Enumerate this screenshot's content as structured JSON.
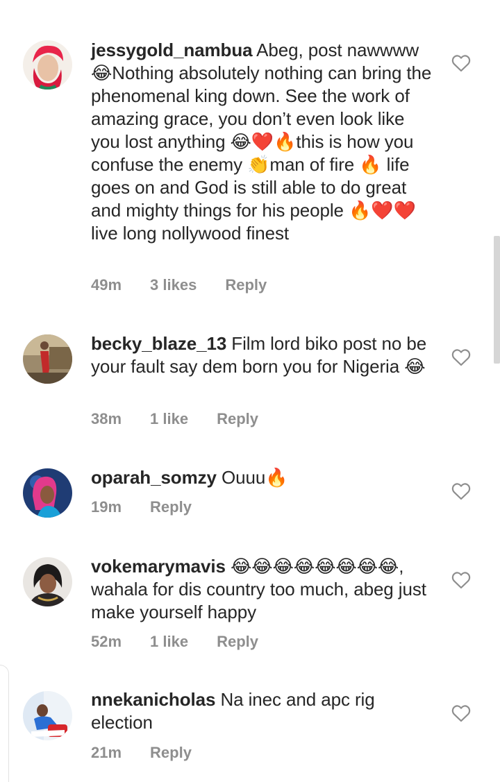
{
  "comments": [
    {
      "username": "jessygold_nambua",
      "text": " Abeg, post nawwww 😂Nothing absolutely nothing can bring the phenomenal king down. See the work of amazing grace, you don’t even look like you lost anything 😂❤️🔥this is how you confuse the enemy 👏man of fire 🔥 life goes on and God is still able to do great and mighty things for his people 🔥❤️❤️live long nollywood finest",
      "time": "49m",
      "likes": "3 likes",
      "reply": "Reply"
    },
    {
      "username": "becky_blaze_13",
      "text": " Film lord biko post no be your fault say dem born you for Nigeria 😂",
      "time": "38m",
      "likes": "1 like",
      "reply": "Reply"
    },
    {
      "username": "oparah_somzy",
      "text": " Ouuu🔥",
      "time": "19m",
      "likes": "",
      "reply": "Reply"
    },
    {
      "username": "vokemarymavis",
      "text": " 😂😂😂😂😂😂😂😂, wahala for dis country too much, abeg just make yourself happy",
      "time": "52m",
      "likes": "1 like",
      "reply": "Reply"
    },
    {
      "username": "nnekanicholas",
      "text": " Na inec and apc rig election",
      "time": "21m",
      "likes": "",
      "reply": "Reply"
    }
  ],
  "icons": {
    "like": "heart-outline-icon"
  },
  "colors": {
    "text": "#262626",
    "meta": "#8e8e8e",
    "heart": "#8e8e8e"
  }
}
